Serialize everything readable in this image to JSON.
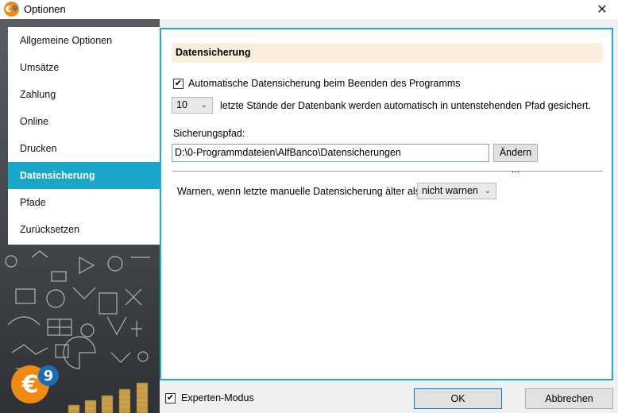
{
  "window": {
    "title": "Optionen",
    "logo_text": "€",
    "logo_num": "9",
    "close_glyph": "✕"
  },
  "sidebar": {
    "items": [
      {
        "label": "Allgemeine Optionen",
        "active": false
      },
      {
        "label": "Umsätze",
        "active": false
      },
      {
        "label": "Zahlung",
        "active": false
      },
      {
        "label": "Online",
        "active": false
      },
      {
        "label": "Drucken",
        "active": false
      },
      {
        "label": "Datensicherung",
        "active": true
      },
      {
        "label": "Pfade",
        "active": false
      },
      {
        "label": "Zurücksetzen",
        "active": false
      }
    ],
    "logo_text": "€",
    "logo_num": "9"
  },
  "main": {
    "section_title": "Datensicherung",
    "auto_backup_checked": true,
    "auto_backup_label": "Automatische Datensicherung beim Beenden des Programms",
    "count_value": "10",
    "count_text": "letzte Stände der Datenbank werden automatisch in untenstehenden Pfad gesichert.",
    "path_label": "Sicherungspfad:",
    "path_value": "D:\\0-Programmdateien\\AlfBanco\\Datensicherungen",
    "change_button": "Ändern ...",
    "warn_label": "Warnen, wenn letzte manuelle Datensicherung älter als",
    "warn_value": "nicht warnen"
  },
  "footer": {
    "expert_mode_checked": true,
    "expert_mode_label": "Experten-Modus",
    "ok_label": "OK",
    "cancel_label": "Abbrechen"
  },
  "colors": {
    "accent": "#1aa6c8",
    "border_accent": "#27a9cf",
    "header_bg": "#fbeedd",
    "logo_orange": "#f08a12"
  },
  "icons": {
    "check": "✔",
    "chevron": "⌄"
  }
}
